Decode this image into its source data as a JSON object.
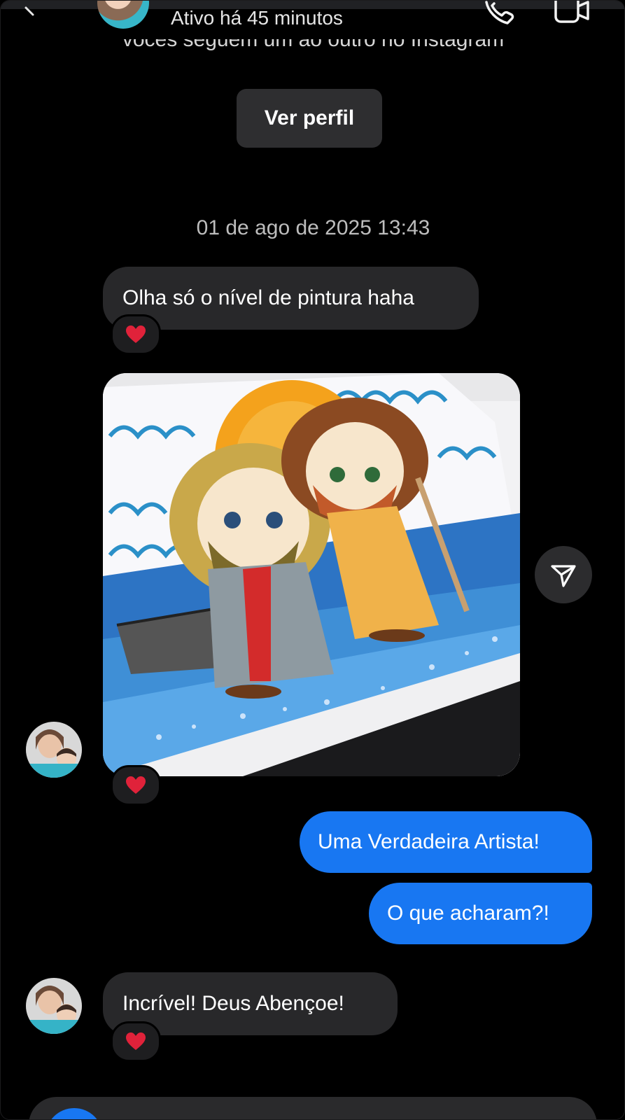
{
  "header": {
    "status": "Ativo há 45 minutos",
    "follow_note": "vocês seguem um ao outro no Instagram",
    "view_profile_label": "Ver perfil"
  },
  "thread": {
    "date": "01 de ago de 2025 13:43",
    "messages": [
      {
        "from": "them",
        "text": "Olha só o nível de pintura haha",
        "reaction": "heart"
      },
      {
        "from": "them",
        "type": "image",
        "reaction": "heart"
      },
      {
        "from": "me",
        "text": "Uma Verdadeira Artista!"
      },
      {
        "from": "me",
        "text": "O que acharam?!"
      },
      {
        "from": "them",
        "text": "Incrível! Deus Abençoe!",
        "reaction": "heart"
      }
    ]
  },
  "colors": {
    "background": "#000000",
    "incoming_bubble": "#28282a",
    "outgoing_bubble": "#1877f2",
    "reaction_heart": "#e0223a"
  },
  "icons": {
    "back": "chevron-left-icon",
    "call": "phone-icon",
    "video": "video-camera-icon",
    "share": "send-icon",
    "reaction": "heart-icon"
  }
}
